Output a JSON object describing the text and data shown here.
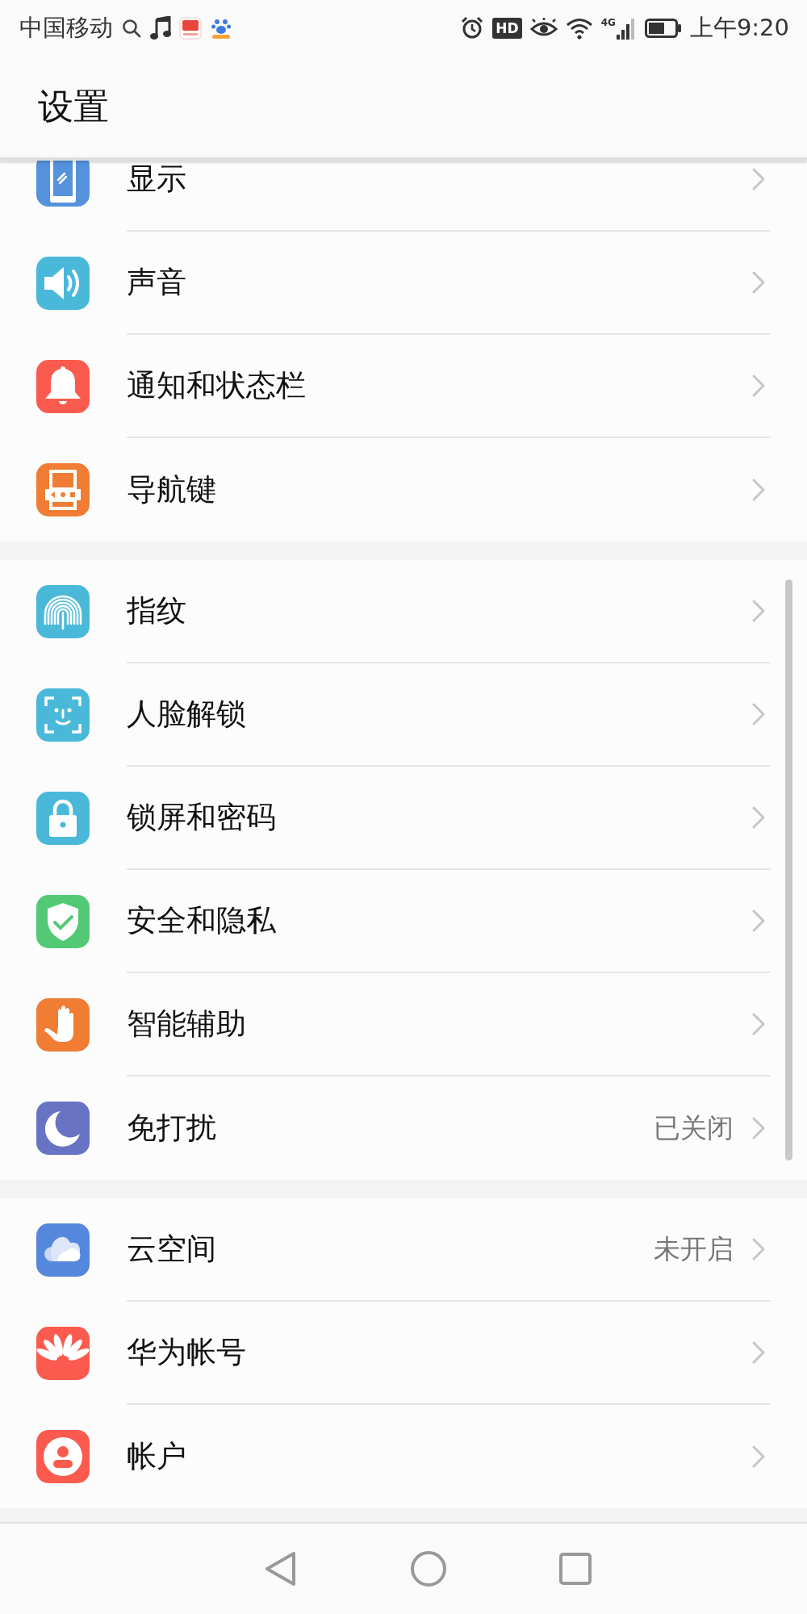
{
  "status_bar": {
    "carrier": "中国移动",
    "hd_badge": "HD",
    "network_type": "4G",
    "time": "上午9:20"
  },
  "header": {
    "title": "设置"
  },
  "groups": [
    {
      "items": [
        {
          "label": "显示"
        },
        {
          "label": "声音"
        },
        {
          "label": "通知和状态栏"
        },
        {
          "label": "导航键"
        }
      ]
    },
    {
      "items": [
        {
          "label": "指纹"
        },
        {
          "label": "人脸解锁"
        },
        {
          "label": "锁屏和密码"
        },
        {
          "label": "安全和隐私"
        },
        {
          "label": "智能辅助"
        },
        {
          "label": "免打扰",
          "value": "已关闭"
        }
      ]
    },
    {
      "items": [
        {
          "label": "云空间",
          "value": "未开启"
        },
        {
          "label": "华为帐号"
        },
        {
          "label": "帐户"
        }
      ]
    }
  ]
}
